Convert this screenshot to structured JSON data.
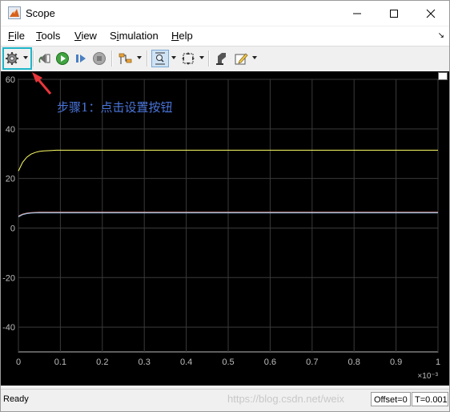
{
  "window": {
    "title": "Scope",
    "icon": "matlab-scope-icon"
  },
  "menu": [
    "File",
    "Tools",
    "View",
    "Simulation",
    "Help"
  ],
  "menu_mnemonics": [
    "F",
    "T",
    "V",
    "i",
    "H"
  ],
  "toolbar": {
    "icons": [
      "settings-gear-icon",
      "step-back-icon",
      "run-icon",
      "step-forward-icon",
      "stop-icon",
      "highlight-signal-icon",
      "zoom-icon",
      "fit-axes-icon",
      "style-icon",
      "edit-icon"
    ],
    "pressed": "zoom-icon"
  },
  "annotation": {
    "text": "步骤1：点击设置按钮",
    "color": "#4a74d9"
  },
  "chart_data": {
    "type": "line",
    "xlim": [
      0,
      1
    ],
    "ylim": [
      -50,
      60
    ],
    "x_exponent_label": "×10⁻³",
    "xticks": [
      "0",
      "0.1",
      "0.2",
      "0.3",
      "0.4",
      "0.5",
      "0.6",
      "0.7",
      "0.8",
      "0.9",
      "1"
    ],
    "yticks": [
      "60",
      "40",
      "20",
      "0",
      "-20",
      "-40"
    ],
    "grid": true,
    "background": "#000000",
    "series": [
      {
        "color": "#ffff66",
        "x": [
          0,
          0.01,
          0.02,
          0.03,
          0.04,
          0.05,
          0.06,
          0.07,
          0.08,
          0.09,
          0.1,
          0.2,
          0.4,
          0.6,
          0.8,
          1.0
        ],
        "values": [
          23,
          26.5,
          28.6,
          29.8,
          30.5,
          30.9,
          31.1,
          31.2,
          31.3,
          31.4,
          31.4,
          31.4,
          31.4,
          31.4,
          31.4,
          31.4
        ]
      },
      {
        "color": "#e49a9a",
        "x": [
          0,
          0.01,
          0.02,
          0.03,
          0.04,
          0.05,
          0.06,
          0.08,
          0.1,
          0.3,
          0.5,
          0.7,
          0.9,
          1.0
        ],
        "values": [
          4.8,
          5.6,
          6.0,
          6.2,
          6.3,
          6.4,
          6.4,
          6.4,
          6.4,
          6.4,
          6.4,
          6.4,
          6.4,
          6.4
        ]
      },
      {
        "color": "#9bc4e6",
        "x": [
          0,
          0.01,
          0.02,
          0.03,
          0.04,
          0.05,
          0.06,
          0.08,
          0.1,
          0.3,
          0.5,
          0.7,
          0.9,
          1.0
        ],
        "values": [
          4.5,
          5.4,
          5.8,
          6.0,
          6.1,
          6.1,
          6.1,
          6.1,
          6.1,
          6.1,
          6.1,
          6.1,
          6.1,
          6.1
        ]
      }
    ]
  },
  "status": {
    "text": "Ready",
    "watermark": "https://blog.csdn.net/weix",
    "offset": "Offset=0",
    "time": "T=0.001"
  }
}
